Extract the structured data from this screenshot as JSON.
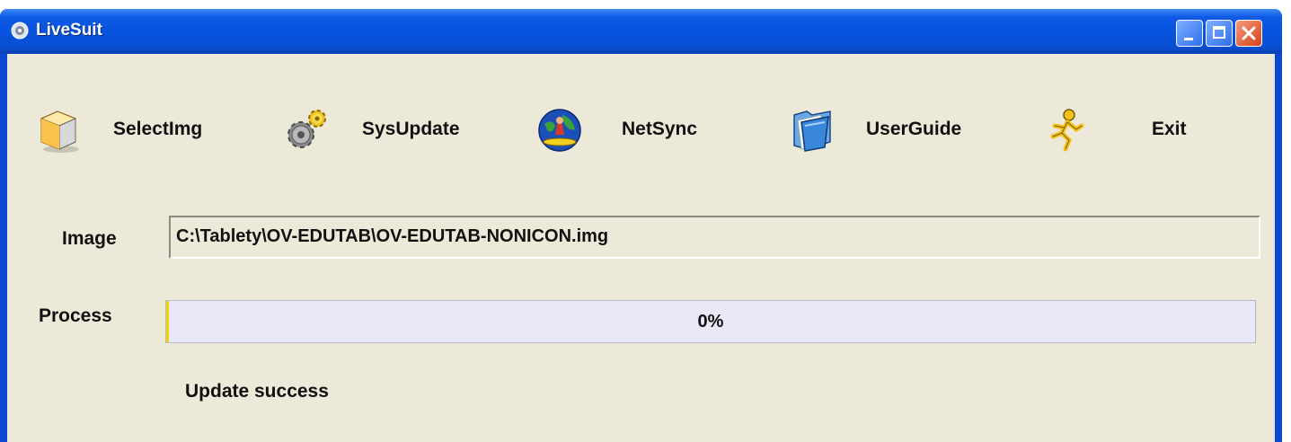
{
  "window": {
    "title": "LiveSuit",
    "icon": "livesuit-app-icon",
    "controls": [
      "minimize",
      "maximize",
      "close"
    ]
  },
  "toolbar": {
    "items": [
      {
        "label": "SelectImg",
        "icon": "select-image-box-icon"
      },
      {
        "label": "SysUpdate",
        "icon": "gear-icon"
      },
      {
        "label": "NetSync",
        "icon": "globe-surfer-icon"
      },
      {
        "label": "UserGuide",
        "icon": "folder-icon"
      },
      {
        "label": "Exit",
        "icon": "running-man-icon"
      }
    ]
  },
  "form": {
    "image_label": "Image",
    "image_path": "C:\\Tablety\\OV-EDUTAB\\OV-EDUTAB-NONICON.img",
    "process_label": "Process",
    "progress_percent": 0,
    "progress_text": "0%",
    "status_text": "Update success"
  },
  "colors": {
    "titlebar": "#0753de",
    "client_bg": "#ece9d8",
    "progress_bg": "#e8e8f8",
    "progress_edge": "#f2d400",
    "close_button": "#d6421c"
  }
}
